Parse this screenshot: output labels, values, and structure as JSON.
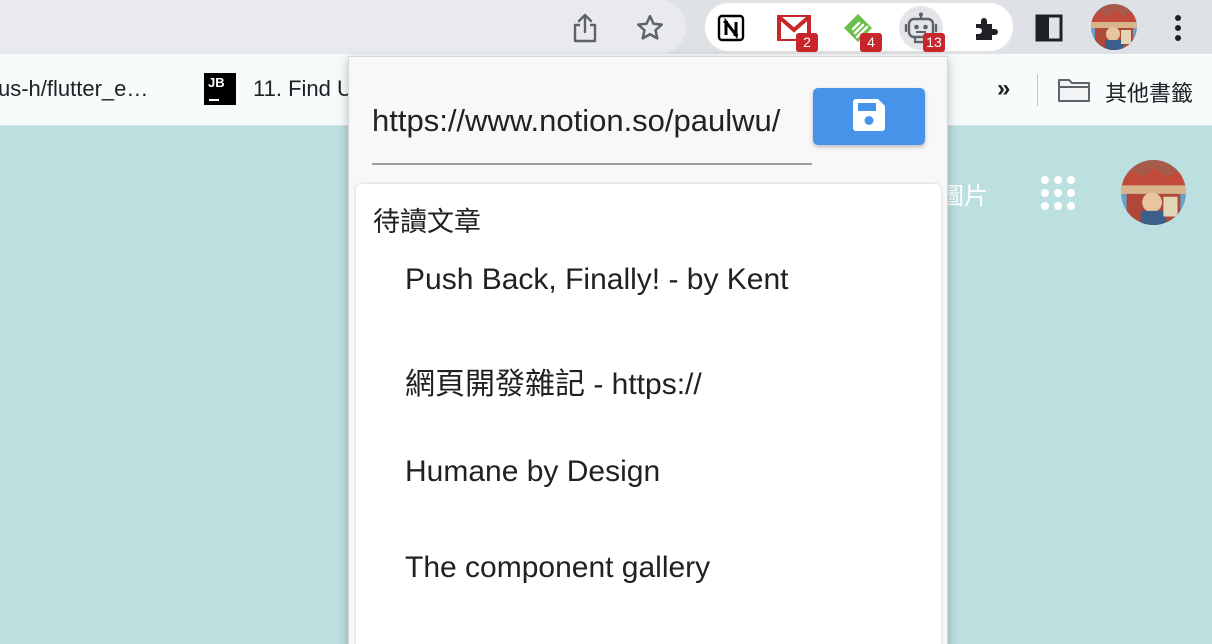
{
  "toolbar": {
    "share_icon": "share-icon",
    "star_icon": "star-icon",
    "extensions": [
      {
        "name": "notion",
        "badge": ""
      },
      {
        "name": "gmail",
        "badge": "2"
      },
      {
        "name": "feedly",
        "badge": "4"
      },
      {
        "name": "robot",
        "badge": "13"
      }
    ],
    "puzzle_icon": "puzzle-icon",
    "sidepanel_icon": "side-panel-icon",
    "menu_icon": "more-vert-icon"
  },
  "bookmarks": {
    "item1": "us-h/flutter_e…",
    "item2_icon": "JB",
    "item2": "11. Find U",
    "overflow": "»",
    "other_folder": "其他書籤"
  },
  "page": {
    "images_link": "圖片"
  },
  "popup": {
    "url_value": "https://www.notion.so/paulwu/",
    "save_icon": "floppy-disk-icon",
    "list_title": "待讀文章",
    "items": [
      "Push Back, Finally! - by Kent",
      "網頁開發雜記 - https://",
      "Humane by Design",
      "The component gallery"
    ]
  },
  "colors": {
    "page_bg": "#bcdfdf",
    "save_button": "#4793ea",
    "badge_red": "#c8262b"
  }
}
